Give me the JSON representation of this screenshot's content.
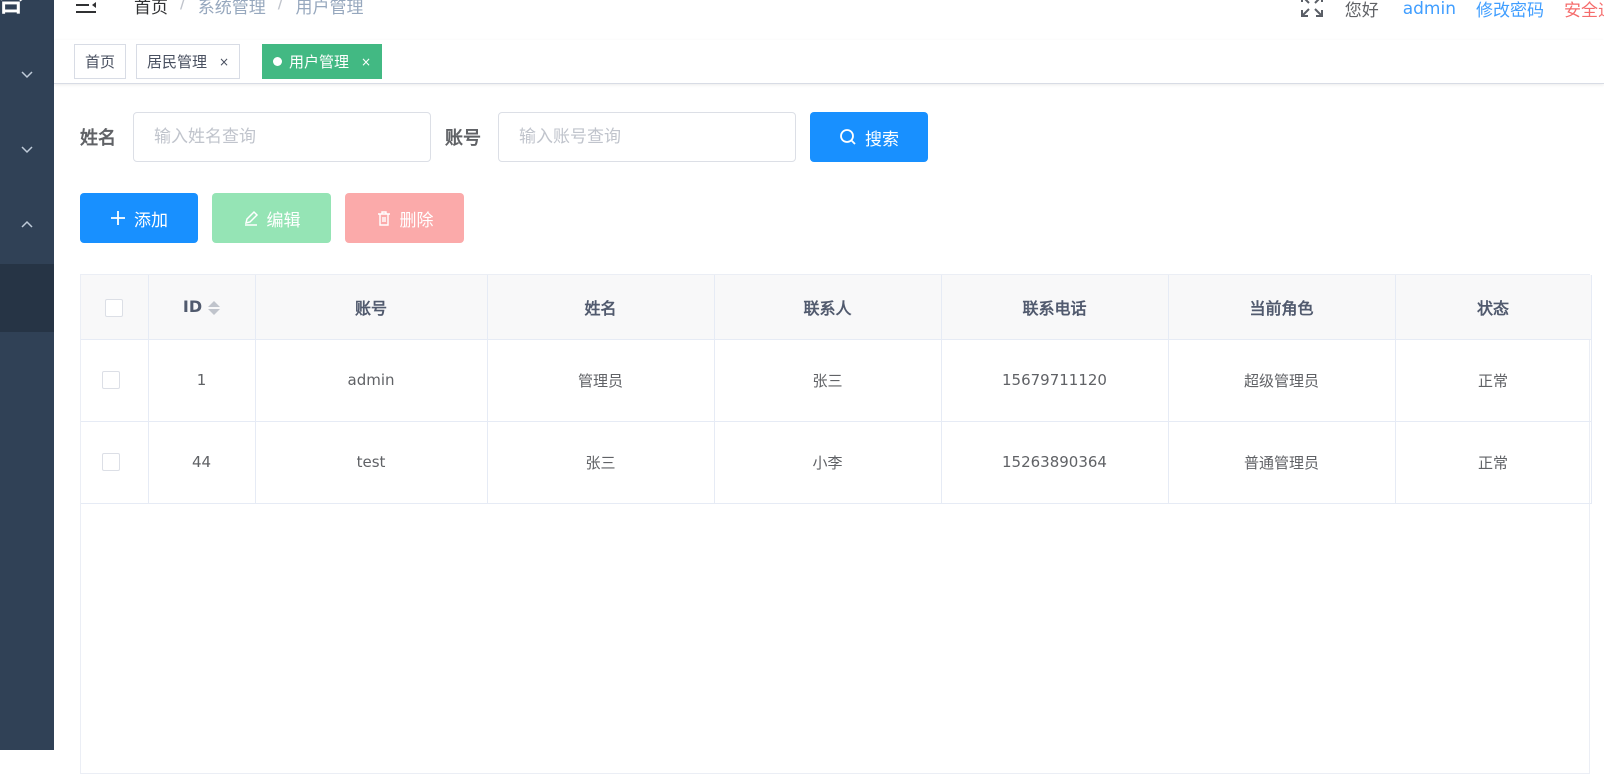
{
  "sidebar": {
    "logo_fragment": "台",
    "menu_icons": [
      "chevron-down",
      "chevron-down",
      "chevron-up"
    ]
  },
  "navbar": {
    "breadcrumb": [
      "首页",
      "系统管理",
      "用户管理"
    ],
    "breadcrumb_sep": "/",
    "greeting": "您好",
    "username": "admin",
    "change_password": "修改密码",
    "logout": "安全退出"
  },
  "tags": [
    {
      "label": "首页",
      "closable": false,
      "active": false
    },
    {
      "label": "居民管理",
      "closable": true,
      "active": false
    },
    {
      "label": "用户管理",
      "closable": true,
      "active": true
    }
  ],
  "tag_close_glyph": "×",
  "search": {
    "name_label": "姓名",
    "name_placeholder": "输入姓名查询",
    "account_label": "账号",
    "account_placeholder": "输入账号查询",
    "search_button": "搜索"
  },
  "toolbar": {
    "add": "添加",
    "edit": "编辑",
    "delete": "删除"
  },
  "table": {
    "columns": [
      "ID",
      "账号",
      "姓名",
      "联系人",
      "联系电话",
      "当前角色",
      "状态"
    ],
    "rows": [
      {
        "id": "1",
        "account": "admin",
        "name": "管理员",
        "contact": "张三",
        "phone": "15679711120",
        "role": "超级管理员",
        "status": "正常"
      },
      {
        "id": "44",
        "account": "test",
        "name": "张三",
        "contact": "小李",
        "phone": "15263890364",
        "role": "普通管理员",
        "status": "正常"
      }
    ]
  },
  "colors": {
    "sidebar_bg": "#304156",
    "primary": "#1890ff",
    "tag_active": "#42b983",
    "danger_text": "#f56c6c",
    "link_text": "#409eff"
  }
}
